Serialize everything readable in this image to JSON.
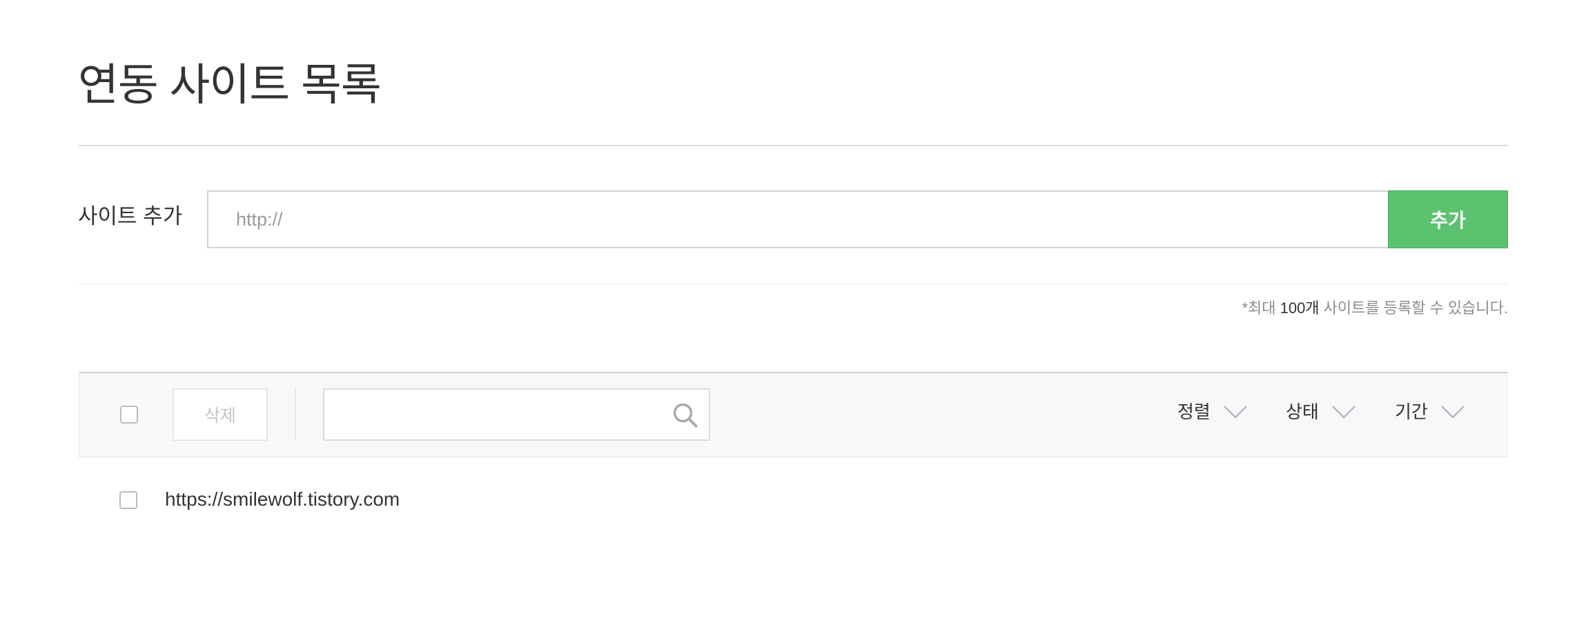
{
  "page": {
    "title": "연동 사이트 목록"
  },
  "add_site": {
    "label": "사이트 추가",
    "input_placeholder": "http://",
    "input_value": "",
    "button_label": "추가"
  },
  "notice": {
    "prefix": "*최대 ",
    "count": "100개",
    "suffix": " 사이트를 등록할 수 있습니다."
  },
  "toolbar": {
    "delete_label": "삭제",
    "search_value": "",
    "search_icon": "search-icon",
    "filters": {
      "sort_label": "정렬",
      "status_label": "상태",
      "period_label": "기간"
    }
  },
  "sites": [
    {
      "url": "https://smilewolf.tistory.com",
      "checked": false
    }
  ],
  "colors": {
    "accent_green": "#5bc26f",
    "text_primary": "#333333",
    "text_muted": "#8c8c8c",
    "toolbar_bg": "#f7f8fa"
  }
}
